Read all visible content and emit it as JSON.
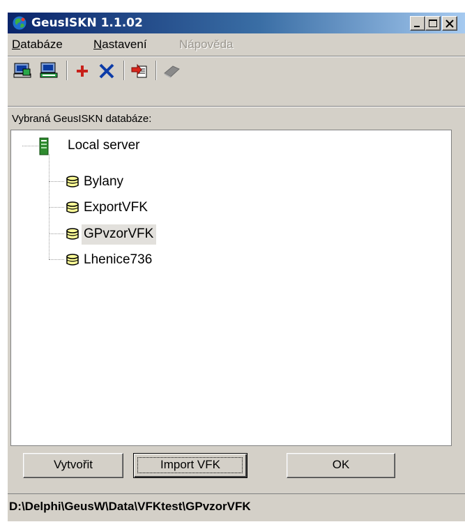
{
  "window": {
    "title": "GeusISKN 1.1.02",
    "controls": [
      "minimize",
      "maximize",
      "close"
    ]
  },
  "menu": {
    "items": [
      {
        "label": "Databáze",
        "accel": "D",
        "rest": "atabáze",
        "enabled": true
      },
      {
        "label": "Nastavení",
        "accel": "N",
        "rest": "astavení",
        "enabled": true
      },
      {
        "label": "Nápověda",
        "accel": "",
        "rest": "",
        "enabled": false
      }
    ]
  },
  "toolbar": {
    "buttons": [
      {
        "icon": "server-connect-icon",
        "enabled": true
      },
      {
        "icon": "server-save-icon",
        "enabled": true
      },
      {
        "icon": "add-plus-icon",
        "enabled": true
      },
      {
        "icon": "delete-x-icon",
        "enabled": true
      },
      {
        "icon": "import-icon",
        "enabled": true
      },
      {
        "icon": "book-icon",
        "enabled": false
      }
    ]
  },
  "database_label": "Vybraná GeusISKN databáze:",
  "tree": {
    "root": {
      "label": "Local server",
      "icon": "server-icon"
    },
    "children": [
      {
        "label": "Bylany",
        "icon": "database-icon",
        "selected": false
      },
      {
        "label": "ExportVFK",
        "icon": "database-icon",
        "selected": false
      },
      {
        "label": "GPvzorVFK",
        "icon": "database-icon",
        "selected": true
      },
      {
        "label": "Lhenice736",
        "icon": "database-icon",
        "selected": false
      }
    ]
  },
  "buttons": {
    "create": "Vytvořit",
    "import": "Import VFK",
    "ok": "OK"
  },
  "status": {
    "path": "D:\\Delphi\\GeusW\\Data\\VFKtest\\GPvzorVFK"
  },
  "colors": {
    "titlebar_start": "#0a246a",
    "titlebar_end": "#a6caf0",
    "face": "#d4d0c8",
    "selection": "#e2e0dc",
    "db_icon_fill": "#ffff99",
    "server_icon": "#2e8b2e"
  }
}
